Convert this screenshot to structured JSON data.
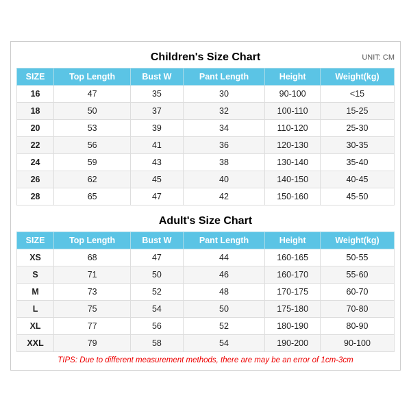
{
  "children_title": "Children's Size Chart",
  "adult_title": "Adult's Size Chart",
  "unit_label": "UNIT: CM",
  "columns": [
    "SIZE",
    "Top Length",
    "Bust W",
    "Pant Length",
    "Height",
    "Weight(kg)"
  ],
  "children_rows": [
    [
      "16",
      "47",
      "35",
      "30",
      "90-100",
      "<15"
    ],
    [
      "18",
      "50",
      "37",
      "32",
      "100-110",
      "15-25"
    ],
    [
      "20",
      "53",
      "39",
      "34",
      "110-120",
      "25-30"
    ],
    [
      "22",
      "56",
      "41",
      "36",
      "120-130",
      "30-35"
    ],
    [
      "24",
      "59",
      "43",
      "38",
      "130-140",
      "35-40"
    ],
    [
      "26",
      "62",
      "45",
      "40",
      "140-150",
      "40-45"
    ],
    [
      "28",
      "65",
      "47",
      "42",
      "150-160",
      "45-50"
    ]
  ],
  "adult_rows": [
    [
      "XS",
      "68",
      "47",
      "44",
      "160-165",
      "50-55"
    ],
    [
      "S",
      "71",
      "50",
      "46",
      "160-170",
      "55-60"
    ],
    [
      "M",
      "73",
      "52",
      "48",
      "170-175",
      "60-70"
    ],
    [
      "L",
      "75",
      "54",
      "50",
      "175-180",
      "70-80"
    ],
    [
      "XL",
      "77",
      "56",
      "52",
      "180-190",
      "80-90"
    ],
    [
      "XXL",
      "79",
      "58",
      "54",
      "190-200",
      "90-100"
    ]
  ],
  "tips": "TIPS: Due to different measurement methods, there are may be an error of 1cm-3cm"
}
